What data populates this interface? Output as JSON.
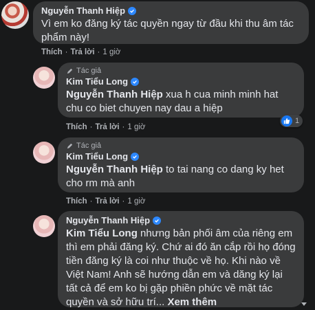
{
  "comments": [
    {
      "name": "Nguyễn Thanh Hiệp",
      "text": "Vì em ko đăng ký tác quyền ngay từ đầu khi thu âm tác phẩm này!",
      "actions": {
        "like": "Thích",
        "reply": "Trả lời",
        "time": "1 giờ"
      }
    }
  ],
  "replies": [
    {
      "author_tag": "Tác giả",
      "name": "Kim Tiểu Long",
      "mention": "Nguyễn Thanh Hiệp",
      "text": " xua h cua minh minh hat chu co biet chuyen nay dau a hiệp",
      "actions": {
        "like": "Thích",
        "reply": "Trả lời",
        "time": "1 giờ"
      },
      "reaction_count": "1"
    },
    {
      "author_tag": "Tác giả",
      "name": "Kim Tiểu Long",
      "mention": "Nguyễn Thanh Hiệp",
      "text": " to tai nang co dang ky het cho rm mà anh",
      "actions": {
        "like": "Thích",
        "reply": "Trả lời",
        "time": "1 giờ"
      }
    },
    {
      "name": "Nguyễn Thanh Hiệp",
      "mention": "Kim Tiểu Long",
      "text": " nhưng bản phối âm của riêng em thì em phải đăng ký. Chứ ai đó ăn cắp rồi họ đóng tiền đăng ký là coi như thuộc về họ. Khi nào về Việt Nam! Anh sẽ hướng dẫn em và dăng ký lại tất cả để em ko bị gặp phiền phức về mặt tác quyền và sở hữu trí...",
      "see_more": "Xem thêm"
    }
  ],
  "colors": {
    "background": "#18191a",
    "bubble": "#3a3b3c",
    "text": "#e4e6eb",
    "secondary": "#b0b3b8",
    "verified": "#2d88ff",
    "like": "#1877f2"
  }
}
